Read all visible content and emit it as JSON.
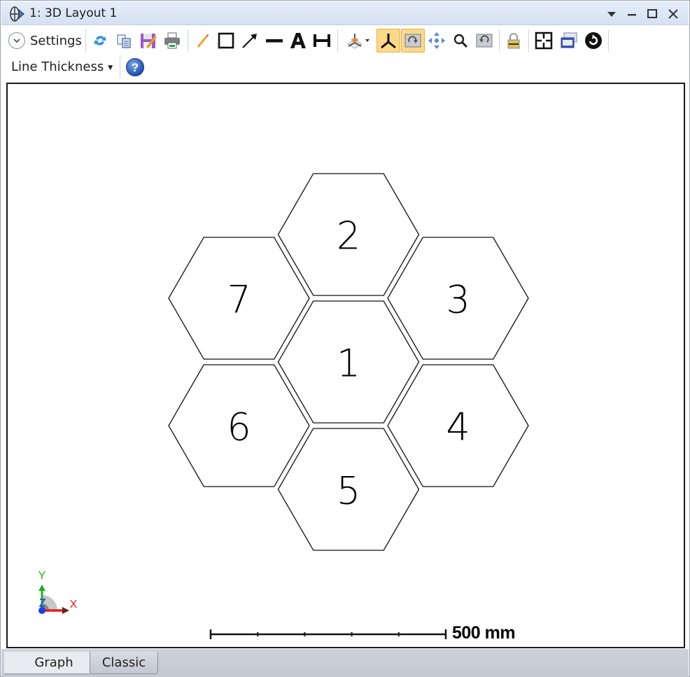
{
  "window": {
    "title": "1: 3D Layout 1",
    "controls": [
      "dropdown-arrow",
      "minimize",
      "maximize",
      "close"
    ]
  },
  "toolbar": {
    "settings_label": "Settings",
    "line_thickness_label": "Line Thickness",
    "buttons": [
      {
        "name": "refresh",
        "icon": "refresh-icon"
      },
      {
        "name": "copy",
        "icon": "copy-icon"
      },
      {
        "name": "save",
        "icon": "save-icon"
      },
      {
        "name": "print",
        "icon": "print-icon"
      },
      {
        "name": "pencil",
        "icon": "pencil-icon"
      },
      {
        "name": "rectangle",
        "icon": "rectangle-icon"
      },
      {
        "name": "arrow",
        "icon": "arrow-icon"
      },
      {
        "name": "line",
        "icon": "line-icon"
      },
      {
        "name": "text",
        "icon": "text-icon"
      },
      {
        "name": "dimension",
        "icon": "dimension-icon"
      },
      {
        "name": "3d-view",
        "icon": "3d-view-icon"
      },
      {
        "name": "axes",
        "icon": "axes-icon",
        "active": true
      },
      {
        "name": "rotate",
        "icon": "rotate-icon",
        "active": true
      },
      {
        "name": "pan",
        "icon": "pan-icon"
      },
      {
        "name": "zoom",
        "icon": "zoom-icon"
      },
      {
        "name": "reset-view",
        "icon": "reset-view-icon"
      },
      {
        "name": "lock",
        "icon": "lock-icon"
      },
      {
        "name": "grid",
        "icon": "grid-icon"
      },
      {
        "name": "windows",
        "icon": "windows-icon"
      },
      {
        "name": "update",
        "icon": "update-icon"
      },
      {
        "name": "help",
        "icon": "help-icon"
      }
    ]
  },
  "canvas": {
    "hexagons": [
      {
        "label": "1",
        "position": "center"
      },
      {
        "label": "2",
        "position": "top"
      },
      {
        "label": "3",
        "position": "upper-right"
      },
      {
        "label": "4",
        "position": "lower-right"
      },
      {
        "label": "5",
        "position": "bottom"
      },
      {
        "label": "6",
        "position": "lower-left"
      },
      {
        "label": "7",
        "position": "upper-left"
      }
    ],
    "axis_labels": {
      "x": "X",
      "y": "Y"
    },
    "axis_colors": {
      "x": "#e02020",
      "y": "#20b020",
      "z": "#2040e0"
    },
    "scale_bar": {
      "label": "500 mm",
      "divisions": 5
    }
  },
  "tabs": [
    {
      "label": "Graph",
      "active": true
    },
    {
      "label": "Classic",
      "active": false
    }
  ]
}
